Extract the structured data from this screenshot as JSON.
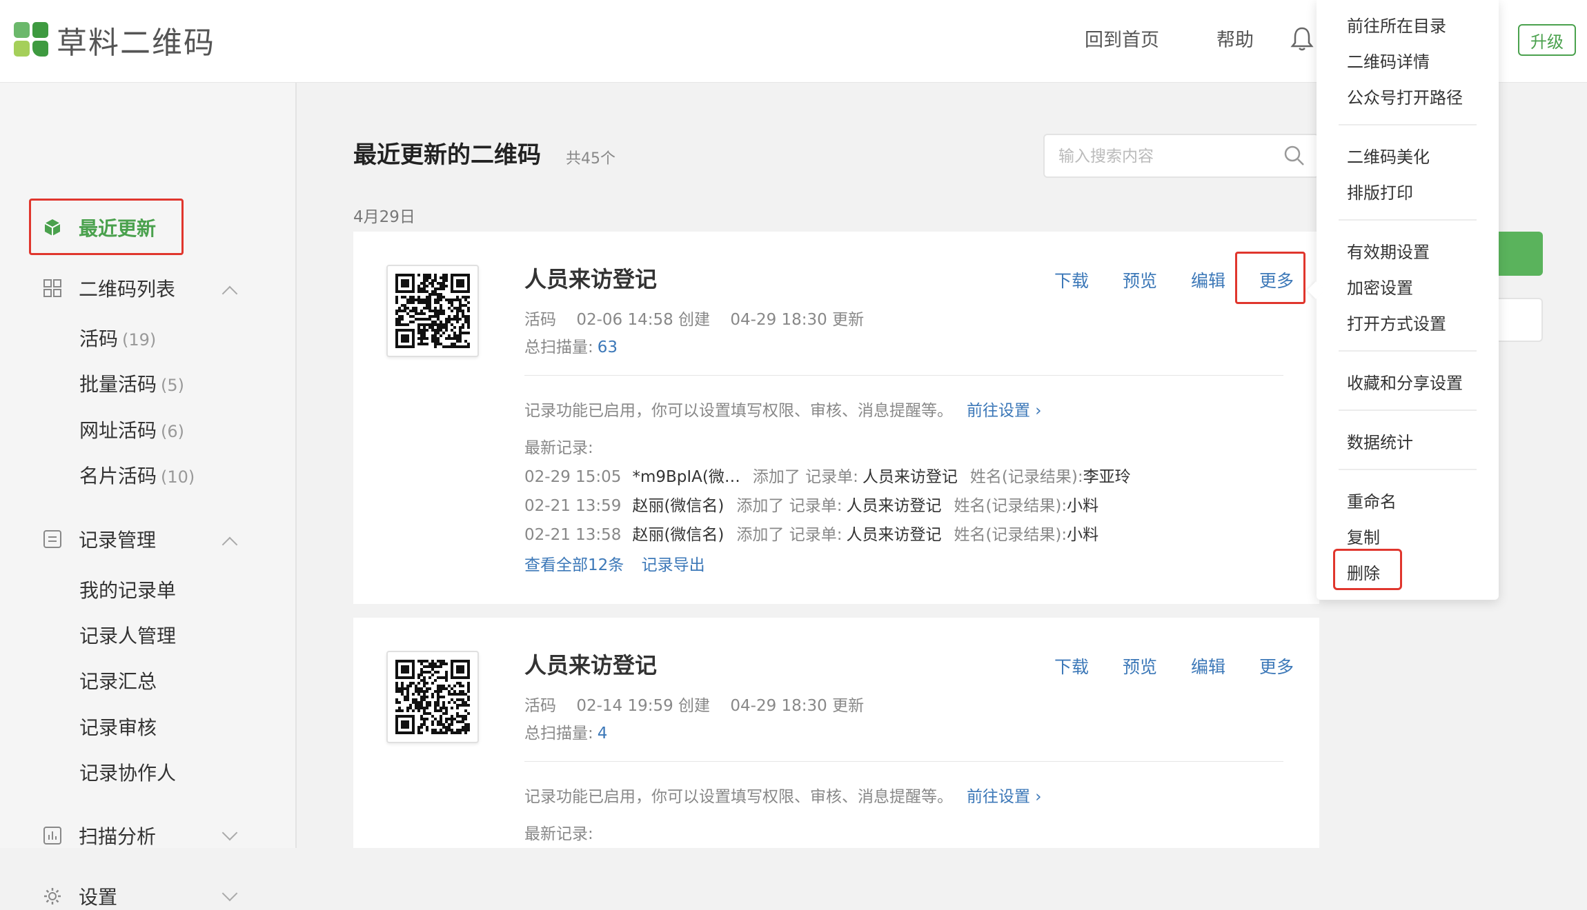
{
  "header": {
    "brand": "草料二维码",
    "nav": {
      "home": "回到首页",
      "help": "帮助"
    },
    "upgrade": "升级"
  },
  "sidebar": {
    "recent": "最近更新",
    "qr_list": {
      "label": "二维码列表",
      "items": [
        {
          "label": "活码",
          "count": "(19)"
        },
        {
          "label": "批量活码",
          "count": "(5)"
        },
        {
          "label": "网址活码",
          "count": "(6)"
        },
        {
          "label": "名片活码",
          "count": "(10)"
        }
      ]
    },
    "records": {
      "label": "记录管理",
      "items": [
        "我的记录单",
        "记录人管理",
        "记录汇总",
        "记录审核",
        "记录协作人"
      ]
    },
    "scan_analysis": "扫描分析",
    "settings": "设置"
  },
  "main": {
    "title": "最近更新的二维码",
    "total": "共45个",
    "search_placeholder": "输入搜索内容",
    "date": "4月29日",
    "actions": {
      "download": "下载",
      "preview": "预览",
      "edit": "编辑",
      "more": "更多"
    },
    "cards": [
      {
        "title": "人员来访登记",
        "type": "活码",
        "created": "02-06 14:58 创建",
        "updated": "04-29 18:30 更新",
        "scan_label": "总扫描量:",
        "scan_count": "63",
        "hint": "记录功能已启用，你可以设置填写权限、审核、消息提醒等。",
        "hint_link": "前往设置 ›",
        "recent_label": "最新记录:",
        "records": [
          {
            "time": "02-29 15:05",
            "who": "*m9BpIA(微…",
            "action": "添加了 记录单:",
            "form": "人员来访登记",
            "field": "姓名(记录结果):",
            "value": "李亚玲"
          },
          {
            "time": "02-21 13:59",
            "who": "赵丽(微信名)",
            "action": "添加了 记录单:",
            "form": "人员来访登记",
            "field": "姓名(记录结果):",
            "value": "小料"
          },
          {
            "time": "02-21 13:58",
            "who": "赵丽(微信名)",
            "action": "添加了 记录单:",
            "form": "人员来访登记",
            "field": "姓名(记录结果):",
            "value": "小料"
          }
        ],
        "view_all": "查看全部12条",
        "export": "记录导出"
      },
      {
        "title": "人员来访登记",
        "type": "活码",
        "created": "02-14 19:59 创建",
        "updated": "04-29 18:30 更新",
        "scan_label": "总扫描量:",
        "scan_count": "4",
        "hint": "记录功能已启用，你可以设置填写权限、审核、消息提醒等。",
        "hint_link": "前往设置 ›",
        "recent_label": "最新记录:"
      }
    ]
  },
  "dropdown": {
    "items": [
      "前往所在目录",
      "二维码详情",
      "公众号打开路径",
      "二维码美化",
      "排版打印",
      "有效期设置",
      "加密设置",
      "打开方式设置",
      "收藏和分享设置",
      "数据统计",
      "重命名",
      "复制",
      "删除"
    ]
  },
  "colors": {
    "brand_green": "#4aa14d",
    "link_blue": "#3c78b8",
    "highlight_red": "#e0362d"
  }
}
